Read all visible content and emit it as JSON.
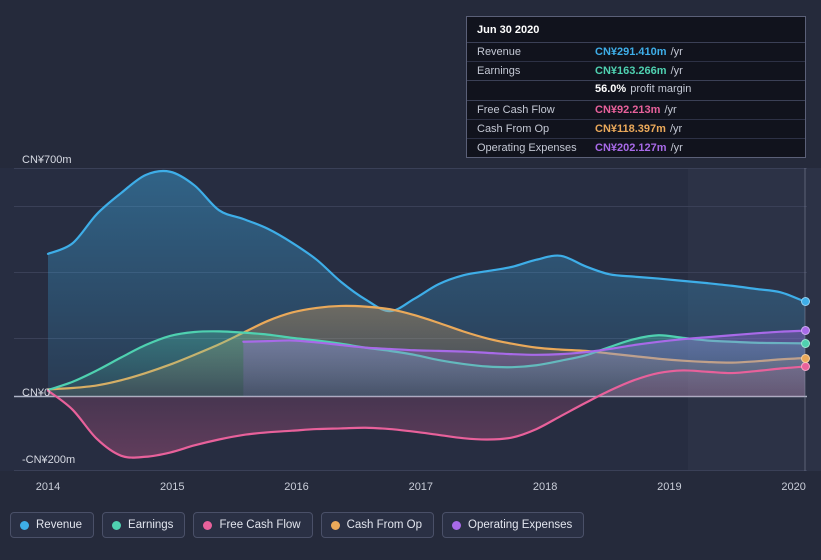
{
  "chart_data": {
    "type": "area",
    "title": "",
    "xlabel": "",
    "ylabel": "",
    "x": [
      "2014",
      "2015",
      "2016",
      "2017",
      "2018",
      "2019",
      "2020"
    ],
    "axis": {
      "y_ticks": [
        "CN¥700m",
        "CN¥0",
        "-CN¥200m"
      ],
      "y_top_label": "CN¥700m",
      "y_zero_label": "CN¥0",
      "y_bottom_label": "-CN¥200m",
      "ylim": [
        -200,
        700
      ],
      "grid": true,
      "legend_position": "bottom"
    },
    "series": [
      {
        "name": "Revenue",
        "color": "#3eaee8",
        "values": [
          438,
          470,
          560,
          625,
          680,
          690,
          648,
          572,
          545,
          515,
          472,
          420,
          352,
          298,
          262,
          300,
          345,
          372,
          385,
          398,
          420,
          432,
          400,
          375,
          368,
          362,
          355,
          348,
          340,
          330,
          320,
          291
        ]
      },
      {
        "name": "Earnings",
        "color": "#4fd1b0",
        "values": [
          20,
          45,
          80,
          120,
          158,
          186,
          198,
          200,
          196,
          190,
          180,
          172,
          162,
          150,
          140,
          128,
          112,
          100,
          92,
          90,
          96,
          110,
          126,
          152,
          176,
          188,
          180,
          172,
          168,
          165,
          164,
          163
        ]
      },
      {
        "name": "Free Cash Flow",
        "color": "#e8619b",
        "values": [
          18,
          -40,
          -130,
          -182,
          -185,
          -172,
          -150,
          -132,
          -118,
          -110,
          -105,
          -100,
          -98,
          -96,
          -100,
          -108,
          -118,
          -128,
          -132,
          -126,
          -100,
          -60,
          -20,
          18,
          50,
          72,
          80,
          76,
          72,
          78,
          86,
          92
        ]
      },
      {
        "name": "Cash From Op",
        "color": "#eaa95a",
        "values": [
          22,
          26,
          34,
          50,
          72,
          98,
          128,
          160,
          196,
          232,
          258,
          272,
          278,
          276,
          268,
          250,
          226,
          200,
          178,
          162,
          150,
          144,
          140,
          132,
          124,
          116,
          110,
          106,
          104,
          108,
          114,
          118
        ]
      },
      {
        "name": "Operating Expenses",
        "color": "#a86ae8",
        "values": [
          null,
          null,
          null,
          null,
          null,
          null,
          null,
          null,
          168,
          170,
          172,
          166,
          158,
          150,
          146,
          142,
          140,
          138,
          134,
          130,
          128,
          130,
          136,
          146,
          158,
          168,
          176,
          182,
          188,
          194,
          199,
          202
        ]
      }
    ]
  },
  "tooltip": {
    "title": "Jun 30 2020",
    "rows": [
      {
        "label": "Revenue",
        "value": "CN¥291.410m",
        "unit": "/yr",
        "color": "#3eaee8"
      },
      {
        "label": "Earnings",
        "value": "CN¥163.266m",
        "unit": "/yr",
        "color": "#4fd1b0"
      },
      {
        "label": "Free Cash Flow",
        "value": "CN¥92.213m",
        "unit": "/yr",
        "color": "#e8619b"
      },
      {
        "label": "Cash From Op",
        "value": "CN¥118.397m",
        "unit": "/yr",
        "color": "#eaa95a"
      },
      {
        "label": "Operating Expenses",
        "value": "CN¥202.127m",
        "unit": "/yr",
        "color": "#a86ae8"
      }
    ],
    "profit_margin_value": "56.0%",
    "profit_margin_text": "profit margin"
  },
  "legend": [
    {
      "label": "Revenue",
      "color": "#3eaee8"
    },
    {
      "label": "Earnings",
      "color": "#4fd1b0"
    },
    {
      "label": "Free Cash Flow",
      "color": "#e8619b"
    },
    {
      "label": "Cash From Op",
      "color": "#eaa95a"
    },
    {
      "label": "Operating Expenses",
      "color": "#a86ae8"
    }
  ],
  "x_axis_labels": [
    "2014",
    "2015",
    "2016",
    "2017",
    "2018",
    "2019",
    "2020"
  ]
}
